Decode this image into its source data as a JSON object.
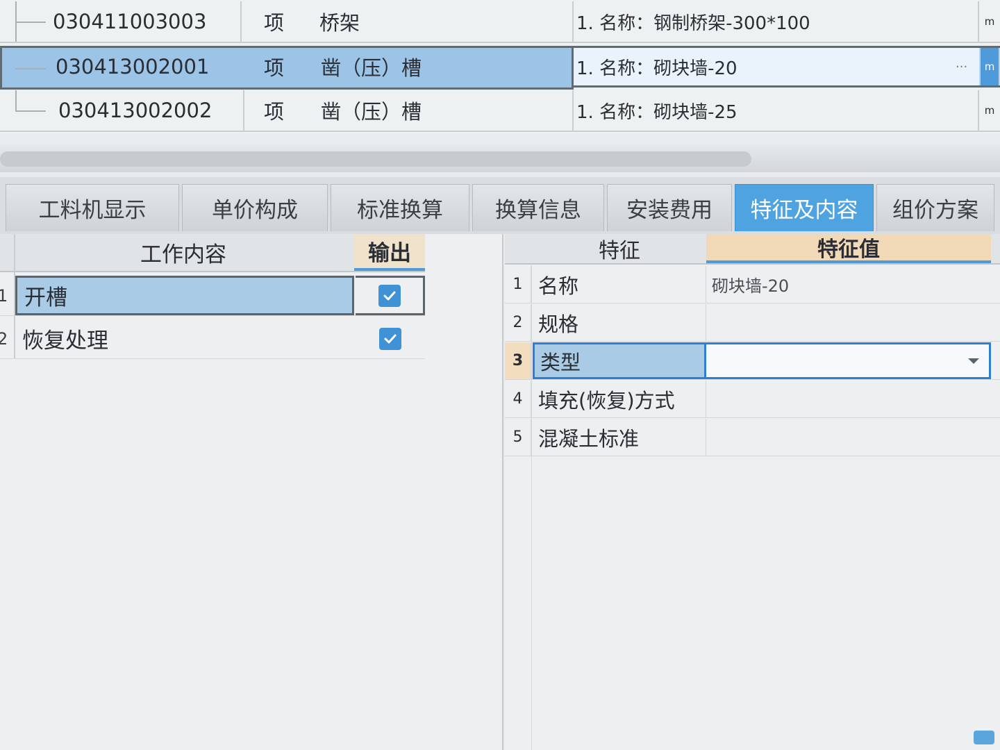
{
  "list": {
    "rows": [
      {
        "code": "030411003003",
        "unit": "项",
        "name": "桥架",
        "feature": "1. 名称：钢制桥架-300*100",
        "m": "m"
      },
      {
        "code": "030413002001",
        "unit": "项",
        "name": "凿（压）槽",
        "feature": "1. 名称：砌块墙-20",
        "m": "m",
        "dots": "···"
      },
      {
        "code": "030413002002",
        "unit": "项",
        "name": "凿（压）槽",
        "feature": "1. 名称：砌块墙-25",
        "m": "m"
      }
    ]
  },
  "tabs": [
    "工料机显示",
    "单价构成",
    "标准换算",
    "换算信息",
    "安装费用",
    "特征及内容",
    "组价方案"
  ],
  "active_tab": "特征及内容",
  "work": {
    "headers": {
      "content": "工作内容",
      "output": "输出"
    },
    "rows": [
      {
        "num": "1",
        "content": "开槽",
        "checked": true
      },
      {
        "num": "2",
        "content": "恢复处理",
        "checked": true
      }
    ]
  },
  "features": {
    "headers": {
      "feature": "特征",
      "value": "特征值"
    },
    "rows": [
      {
        "num": "1",
        "name": "名称",
        "value": "砌块墙-20"
      },
      {
        "num": "2",
        "name": "规格",
        "value": ""
      },
      {
        "num": "3",
        "name": "类型",
        "value": ""
      },
      {
        "num": "4",
        "name": "填充(恢复)方式",
        "value": ""
      },
      {
        "num": "5",
        "name": "混凝土标准",
        "value": ""
      }
    ],
    "selected_row": "3"
  },
  "colors": {
    "accent": "#4fa3e0",
    "selection": "#a9cbe6",
    "header_highlight": "#f1d9b7"
  }
}
